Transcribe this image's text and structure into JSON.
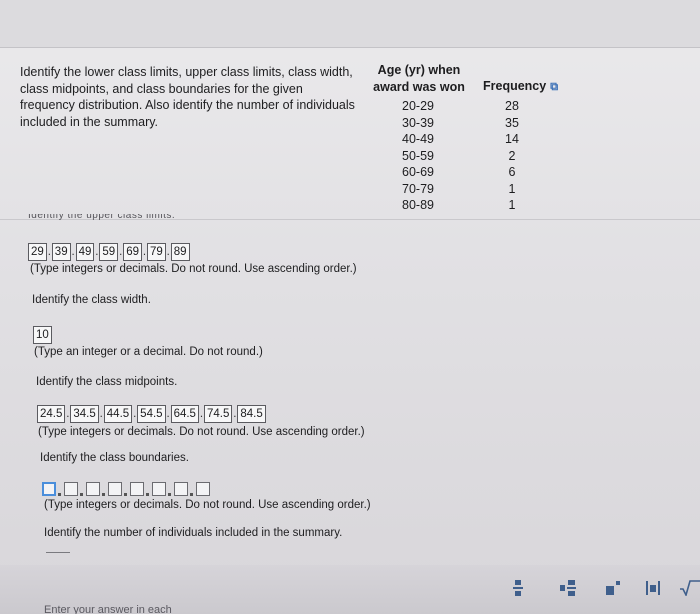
{
  "question": {
    "text": "Identify the lower class limits, upper class limits, class width, class midpoints, and class boundaries for the given frequency distribution. Also identify the number of individuals included in the summary."
  },
  "table": {
    "age_header": "Age (yr) when award was won",
    "freq_header": "Frequency",
    "rows": [
      {
        "age": "20-29",
        "freq": "28"
      },
      {
        "age": "30-39",
        "freq": "35"
      },
      {
        "age": "40-49",
        "freq": "14"
      },
      {
        "age": "50-59",
        "freq": "2"
      },
      {
        "age": "60-69",
        "freq": "6"
      },
      {
        "age": "70-79",
        "freq": "1"
      },
      {
        "age": "80-89",
        "freq": "1"
      }
    ]
  },
  "cut_off_label": "Identify the upper class limits.",
  "upper_limits": {
    "values": [
      "29",
      "39",
      "49",
      "59",
      "69",
      "79",
      "89"
    ],
    "hint": "(Type integers or decimals. Do not round. Use ascending order.)"
  },
  "class_width": {
    "label": "Identify the class width.",
    "value": "10",
    "hint": "(Type an integer or a decimal. Do not round.)"
  },
  "midpoints": {
    "label": "Identify the class midpoints.",
    "values": [
      "24.5",
      "34.5",
      "44.5",
      "54.5",
      "64.5",
      "74.5",
      "84.5"
    ],
    "hint": "(Type integers or decimals. Do not round. Use ascending order.)"
  },
  "boundaries": {
    "label": "Identify the class boundaries.",
    "hint": "(Type integers or decimals. Do not round. Use ascending order.)"
  },
  "individuals": {
    "label": "Identify the number of individuals included in the summary."
  },
  "footer": {
    "enter_answer": "Enter your answer in each"
  },
  "colors": {
    "accent": "#4a8edb",
    "toolbar_icon": "#3f5f8c"
  }
}
